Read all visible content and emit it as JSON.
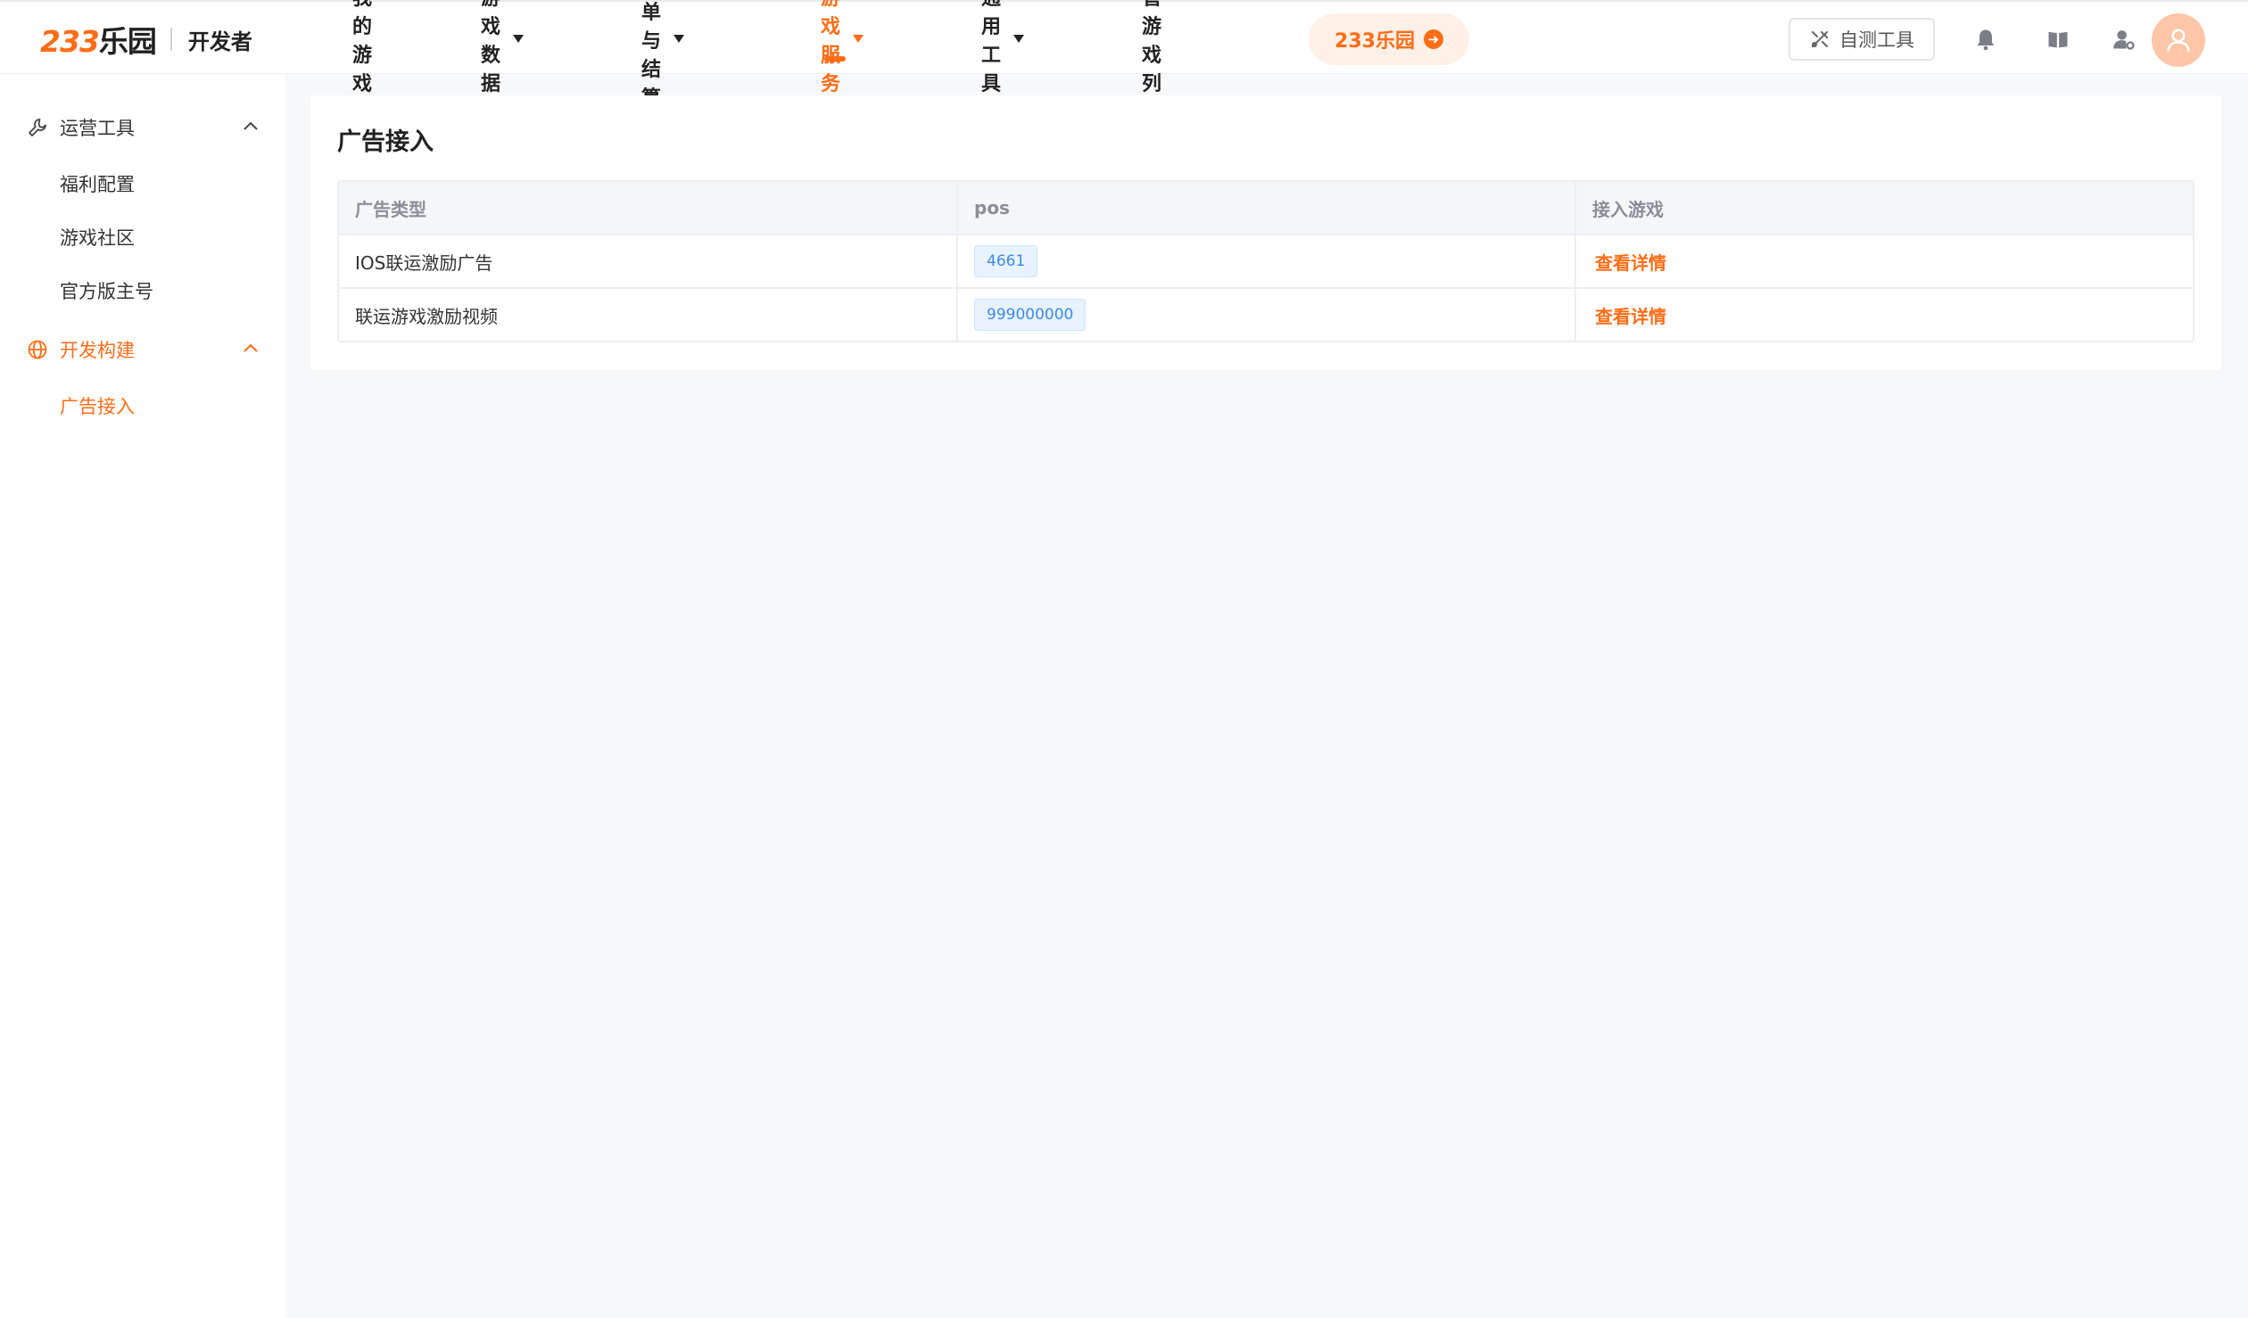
{
  "header": {
    "logo_mark": "233",
    "logo_mark_suffix": "乐园",
    "logo_text": "开发者",
    "nav": [
      {
        "label": "我的游戏",
        "has_dropdown": false
      },
      {
        "label": "游戏数据",
        "has_dropdown": true
      },
      {
        "label": "订单与结算",
        "has_dropdown": true
      },
      {
        "label": "游戏服务",
        "has_dropdown": true,
        "active": true
      },
      {
        "label": "通用工具",
        "has_dropdown": true
      },
      {
        "label": "超管游戏列表",
        "has_dropdown": false
      }
    ],
    "pill_label": "233乐园",
    "self_test_label": "自测工具",
    "icons": [
      "bell-icon",
      "book-icon",
      "user-settings-icon",
      "avatar-user-icon"
    ]
  },
  "sidebar": {
    "groups": [
      {
        "label": "运营工具",
        "icon": "wrench-icon",
        "expanded": true,
        "items": [
          "福利配置",
          "游戏社区",
          "官方版主号"
        ]
      },
      {
        "label": "开发构建",
        "icon": "globe-icon",
        "expanded": true,
        "active": true,
        "items": [
          "广告接入"
        ]
      }
    ],
    "active_item": "广告接入"
  },
  "main": {
    "title": "广告接入",
    "table": {
      "columns": [
        "广告类型",
        "pos",
        "接入游戏"
      ],
      "rows": [
        {
          "type": "IOS联运激励广告",
          "pos": "4661",
          "action": "查看详情"
        },
        {
          "type": "联运游戏激励视频",
          "pos": "999000000",
          "action": "查看详情"
        }
      ]
    }
  },
  "colors": {
    "accent": "#ff6d17",
    "accent_light": "#fff1e8",
    "tag_blue": "#3d8ae6",
    "tag_bg": "#e8f3ff",
    "page_bg": "#f7f8fa"
  }
}
